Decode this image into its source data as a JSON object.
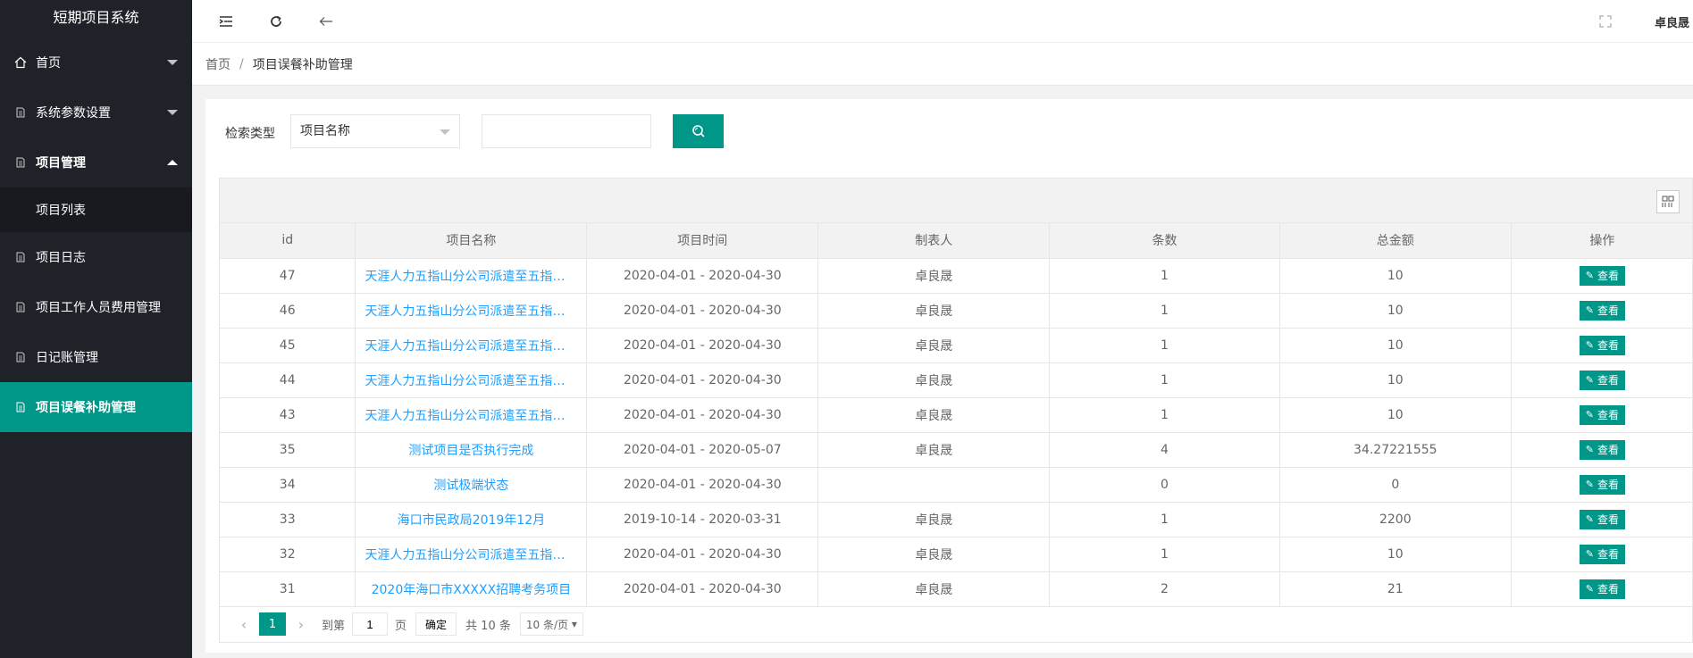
{
  "app": {
    "title": "短期项目系统"
  },
  "sidebar": {
    "items": [
      {
        "label": "首页"
      },
      {
        "label": "系统参数设置"
      },
      {
        "label": "项目管理"
      },
      {
        "label": "项目列表"
      },
      {
        "label": "项目日志"
      },
      {
        "label": "项目工作人员费用管理"
      },
      {
        "label": "日记账管理"
      },
      {
        "label": "项目误餐补助管理"
      }
    ]
  },
  "header": {
    "user": "卓良晟"
  },
  "breadcrumb": {
    "home": "首页",
    "sep": "/",
    "current": "项目误餐补助管理"
  },
  "search": {
    "label": "检索类型",
    "select_value": "项目名称",
    "input_value": ""
  },
  "table": {
    "headers": [
      "id",
      "项目名称",
      "项目时间",
      "制表人",
      "条数",
      "总金额",
      "操作"
    ],
    "view_label": "查看",
    "rows": [
      {
        "id": "47",
        "name": "天涯人力五指山分公司派遣至五指山市...",
        "time": "2020-04-01 - 2020-04-30",
        "maker": "卓良晟",
        "count": "1",
        "total": "10"
      },
      {
        "id": "46",
        "name": "天涯人力五指山分公司派遣至五指山市...",
        "time": "2020-04-01 - 2020-04-30",
        "maker": "卓良晟",
        "count": "1",
        "total": "10"
      },
      {
        "id": "45",
        "name": "天涯人力五指山分公司派遣至五指山市...",
        "time": "2020-04-01 - 2020-04-30",
        "maker": "卓良晟",
        "count": "1",
        "total": "10"
      },
      {
        "id": "44",
        "name": "天涯人力五指山分公司派遣至五指山市...",
        "time": "2020-04-01 - 2020-04-30",
        "maker": "卓良晟",
        "count": "1",
        "total": "10"
      },
      {
        "id": "43",
        "name": "天涯人力五指山分公司派遣至五指山市...",
        "time": "2020-04-01 - 2020-04-30",
        "maker": "卓良晟",
        "count": "1",
        "total": "10"
      },
      {
        "id": "35",
        "name": "测试项目是否执行完成",
        "time": "2020-04-01 - 2020-05-07",
        "maker": "卓良晟",
        "count": "4",
        "total": "34.27221555"
      },
      {
        "id": "34",
        "name": "测试极端状态",
        "time": "2020-04-01 - 2020-04-30",
        "maker": "",
        "count": "0",
        "total": "0"
      },
      {
        "id": "33",
        "name": "海口市民政局2019年12月",
        "time": "2019-10-14 - 2020-03-31",
        "maker": "卓良晟",
        "count": "1",
        "total": "2200"
      },
      {
        "id": "32",
        "name": "天涯人力五指山分公司派遣至五指山市...",
        "time": "2020-04-01 - 2020-04-30",
        "maker": "卓良晟",
        "count": "1",
        "total": "10"
      },
      {
        "id": "31",
        "name": "2020年海口市XXXXX招聘考务项目",
        "time": "2020-04-01 - 2020-04-30",
        "maker": "卓良晟",
        "count": "2",
        "total": "21"
      }
    ]
  },
  "pager": {
    "current": "1",
    "goto_label": "到第",
    "goto_value": "1",
    "page_label": "页",
    "ok_label": "确定",
    "total": "共 10 条",
    "size": "10 条/页"
  }
}
